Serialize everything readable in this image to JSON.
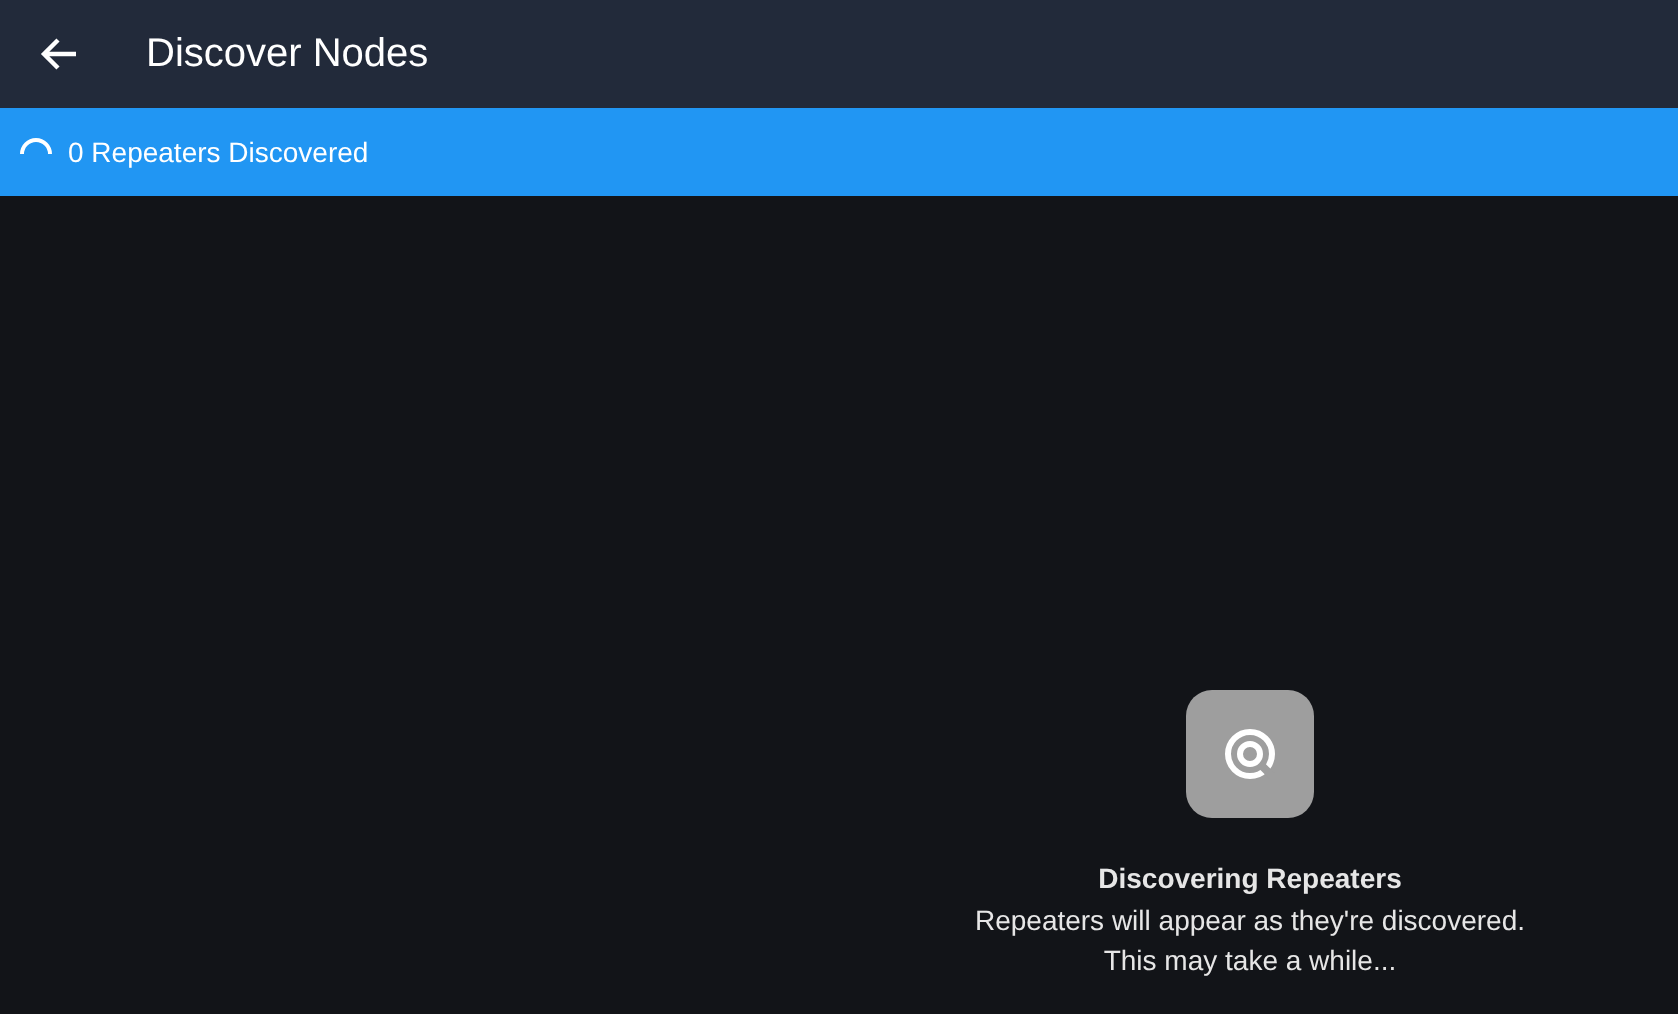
{
  "app_bar": {
    "title": "Discover Nodes"
  },
  "status_bar": {
    "loading": true,
    "text": "0 Repeaters Discovered"
  },
  "empty_state": {
    "title": "Discovering Repeaters",
    "lines": [
      "Repeaters will appear as they're discovered.",
      "This may take a while..."
    ]
  }
}
